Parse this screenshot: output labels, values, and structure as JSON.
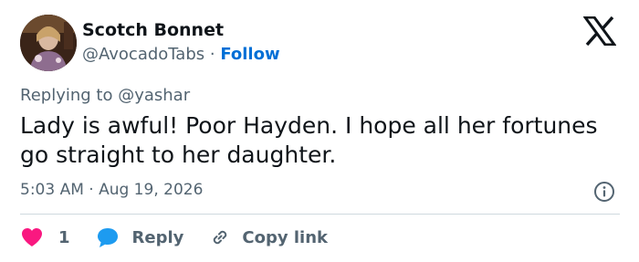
{
  "user": {
    "display_name": "Scotch Bonnet",
    "handle": "@AvocadoTabs",
    "separator": " · ",
    "follow_label": "Follow"
  },
  "replying_to": "Replying to @yashar",
  "tweet": {
    "text": "Lady is awful! Poor Hayden. I hope all her fortunes go straight to her daughter.",
    "timestamp": "5:03 AM · Aug 19, 2026"
  },
  "actions": {
    "like_count": "1",
    "reply_label": "Reply",
    "copy_link_label": "Copy link"
  },
  "icons": {
    "brand": "x-logo-icon",
    "info": "info-icon",
    "like": "heart-icon",
    "reply": "speech-bubble-icon",
    "copy": "link-icon"
  },
  "colors": {
    "text_primary": "#0f1419",
    "text_secondary": "#536471",
    "link_blue": "#006fd6",
    "like_pink": "#f91880",
    "reply_blue": "#1d9bf0",
    "divider": "#cfd9de"
  }
}
